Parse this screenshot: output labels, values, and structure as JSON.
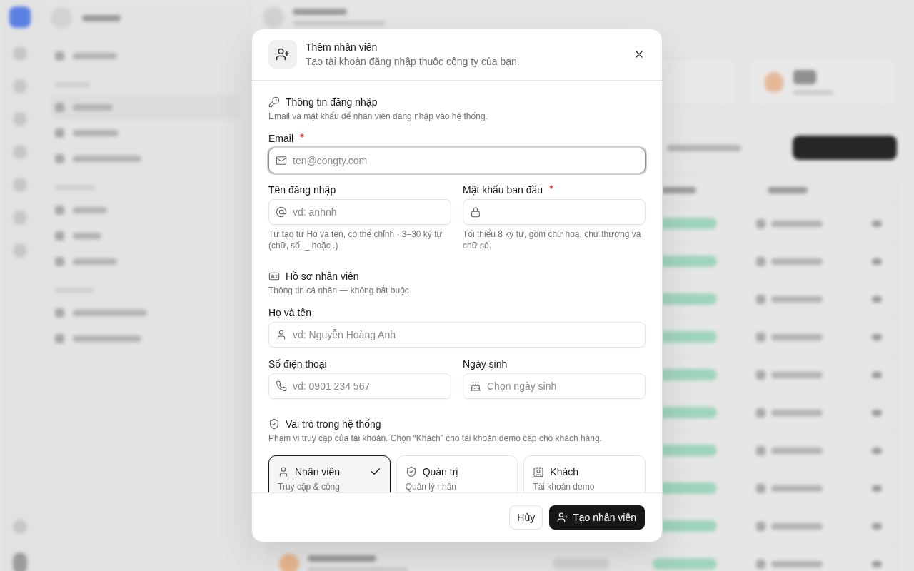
{
  "dialog": {
    "title": "Thêm nhân viên",
    "subtitle": "Tạo tài khoản đăng nhập thuộc công ty của bạn."
  },
  "sections": [
    {
      "kind": "login",
      "title": "Thông tin đăng nhập",
      "description": "Email và mật khẩu để nhân viên đăng nhập vào hệ thống.",
      "rows": [
        [
          {
            "kind": "email",
            "label": "Email",
            "required": true,
            "placeholder": "ten@congty.com",
            "focused": true
          }
        ],
        [
          {
            "kind": "username",
            "label": "Tên đăng nhập",
            "required": false,
            "placeholder": "vd: anhnh",
            "focused": false,
            "hint": "Tự tạo từ Họ và tên, có thể chỉnh · 3–30 ký tự (chữ, số, _ hoặc .)"
          },
          {
            "kind": "password",
            "label": "Mật khẩu ban đầu",
            "required": true,
            "focused": false,
            "hint": "Tối thiểu 8 ký tự, gồm chữ hoa, chữ thường và chữ số."
          }
        ]
      ]
    },
    {
      "kind": "profile",
      "title": "Hồ sơ nhân viên",
      "description": "Thông tin cá nhân — không bắt buộc.",
      "rows": [
        [
          {
            "kind": "name",
            "label": "Họ và tên",
            "required": false,
            "placeholder": "vd: Nguyễn Hoàng Anh",
            "focused": false
          }
        ],
        [
          {
            "kind": "phone",
            "label": "Số điện thoại",
            "required": false,
            "placeholder": "vd: 0901 234 567",
            "focused": false
          },
          {
            "kind": "date",
            "label": "Ngày sinh",
            "required": false,
            "placeholder": "Chọn ngày sinh",
            "focused": false
          }
        ]
      ]
    },
    {
      "kind": "role",
      "title": "Vai trò trong hệ thống",
      "description": "Phạm vi truy cập của tài khoản. Chọn “Khách” cho tài khoản demo cấp cho khách hàng.",
      "roles": [
        {
          "kind": "staff",
          "name": "Nhân viên",
          "description": "Truy cập & cộng",
          "selected": true
        },
        {
          "kind": "admin",
          "name": "Quản trị",
          "description": "Quản lý nhân",
          "selected": false
        },
        {
          "kind": "guest",
          "name": "Khách",
          "description": "Tài khoản demo",
          "selected": false
        }
      ]
    }
  ],
  "footer": {
    "cancel": "Hủy",
    "submit": "Tạo nhân viên"
  }
}
